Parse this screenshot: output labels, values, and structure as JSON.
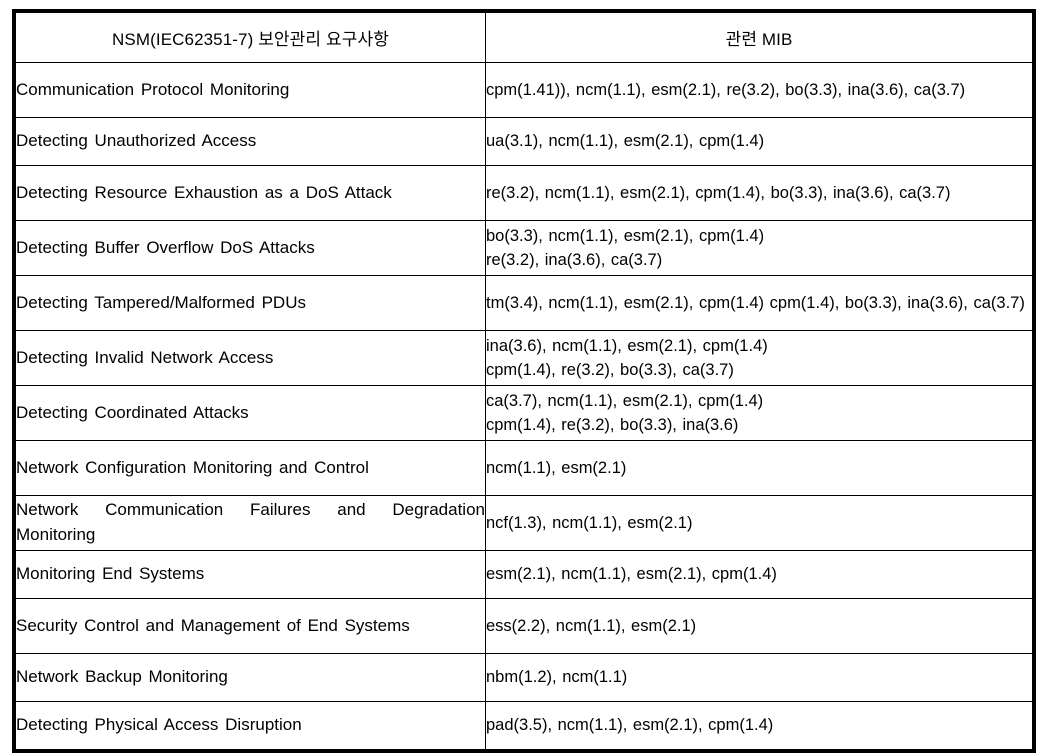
{
  "table": {
    "headers": {
      "requirement": "NSM(IEC62351-7) 보안관리 요구사항",
      "mib": "관련 MIB"
    },
    "rows": [
      {
        "requirement": "Communication Protocol Monitoring",
        "mib": "cpm(1.41)), ncm(1.1), esm(2.1), re(3.2), bo(3.3), ina(3.6), ca(3.7)",
        "req_lines": 1,
        "mib_lines": 2
      },
      {
        "requirement": "Detecting Unauthorized Access",
        "mib": "ua(3.1), ncm(1.1), esm(2.1), cpm(1.4)",
        "req_lines": 1,
        "mib_lines": 1
      },
      {
        "requirement": "Detecting Resource Exhaustion as a DoS Attack",
        "mib": "re(3.2), ncm(1.1), esm(2.1), cpm(1.4), bo(3.3), ina(3.6), ca(3.7)",
        "req_lines": 2,
        "mib_lines": 2
      },
      {
        "requirement": "Detecting Buffer Overflow DoS Attacks",
        "mib": "bo(3.3), ncm(1.1), esm(2.1), cpm(1.4)\nre(3.2), ina(3.6), ca(3.7)",
        "req_lines": 1,
        "mib_lines": 2
      },
      {
        "requirement": "Detecting Tampered/Malformed PDUs",
        "mib": "tm(3.4), ncm(1.1), esm(2.1), cpm(1.4) cpm(1.4), bo(3.3), ina(3.6), ca(3.7)",
        "req_lines": 1,
        "mib_lines": 2
      },
      {
        "requirement": "Detecting Invalid Network Access",
        "mib": "ina(3.6), ncm(1.1), esm(2.1), cpm(1.4)\ncpm(1.4), re(3.2), bo(3.3), ca(3.7)",
        "req_lines": 1,
        "mib_lines": 2
      },
      {
        "requirement": "Detecting Coordinated Attacks",
        "mib": "ca(3.7), ncm(1.1), esm(2.1), cpm(1.4)\ncpm(1.4), re(3.2), bo(3.3), ina(3.6)",
        "req_lines": 1,
        "mib_lines": 2
      },
      {
        "requirement": "Network Configuration Monitoring and Control",
        "mib": "ncm(1.1), esm(2.1)",
        "req_lines": 2,
        "mib_lines": 1
      },
      {
        "requirement": "Network Communication Failures and Degradation Monitoring",
        "mib": "ncf(1.3), ncm(1.1), esm(2.1)",
        "req_lines": 2,
        "mib_lines": 1
      },
      {
        "requirement": "Monitoring End Systems",
        "mib": "esm(2.1), ncm(1.1), esm(2.1), cpm(1.4)",
        "req_lines": 1,
        "mib_lines": 1
      },
      {
        "requirement": "Security Control and Management of End Systems",
        "mib": "ess(2.2), ncm(1.1), esm(2.1)",
        "req_lines": 2,
        "mib_lines": 1
      },
      {
        "requirement": "Network Backup Monitoring",
        "mib": "nbm(1.2), ncm(1.1)",
        "req_lines": 1,
        "mib_lines": 1
      },
      {
        "requirement": "Detecting Physical Access Disruption",
        "mib": "pad(3.5), ncm(1.1), esm(2.1), cpm(1.4)",
        "req_lines": 1,
        "mib_lines": 1
      }
    ]
  }
}
